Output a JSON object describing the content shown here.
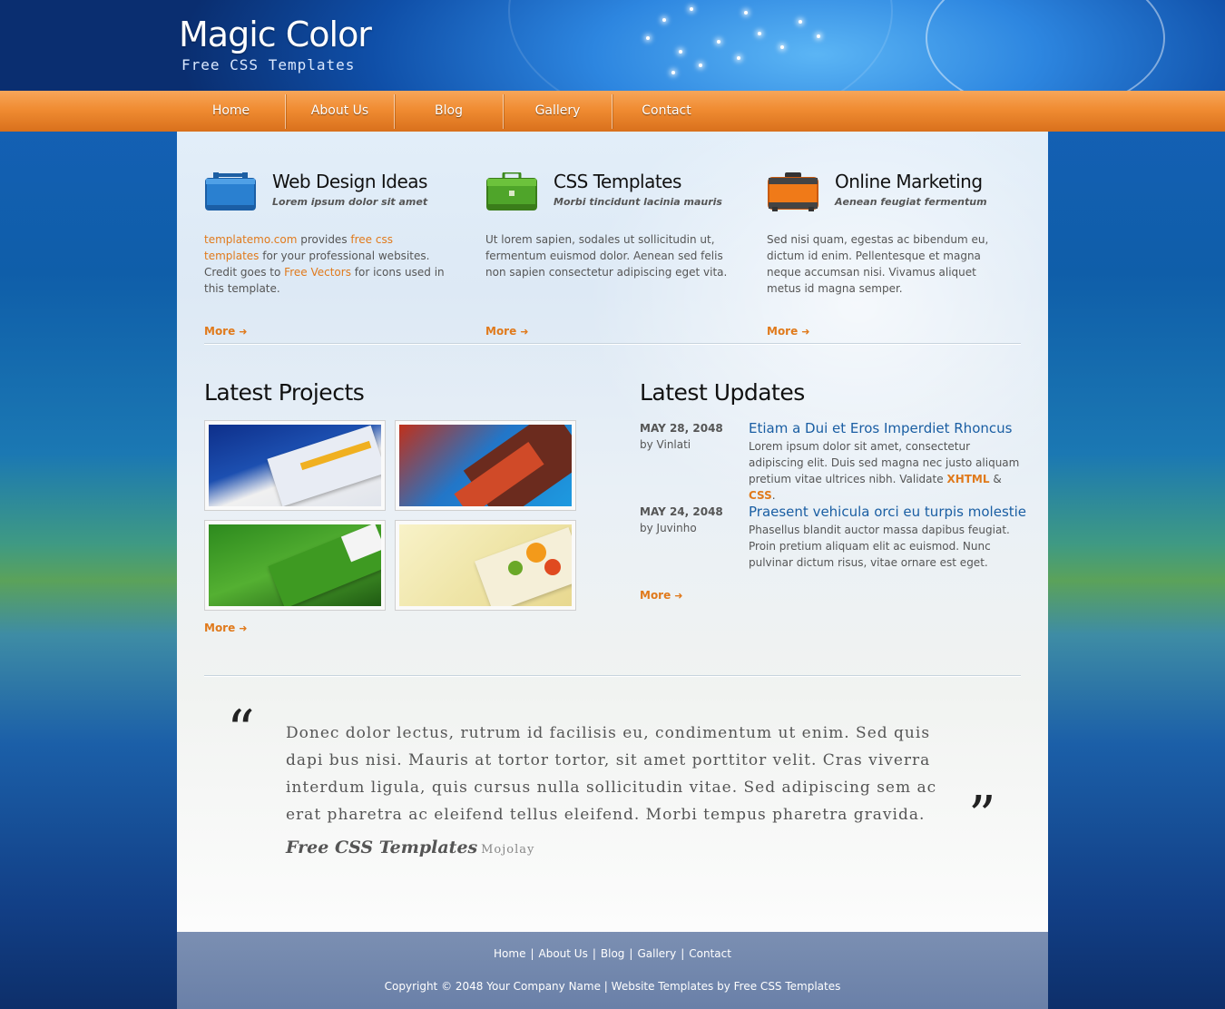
{
  "site": {
    "title": "Magic Color",
    "tagline": "Free CSS Templates"
  },
  "nav": {
    "items": [
      {
        "label": "Home"
      },
      {
        "label": "About Us"
      },
      {
        "label": "Blog"
      },
      {
        "label": "Gallery"
      },
      {
        "label": "Contact"
      }
    ]
  },
  "features": [
    {
      "icon": "blue-briefcase-icon",
      "title": "Web Design Ideas",
      "subtitle": "Lorem ipsum dolor sit amet",
      "text_parts": [
        "templatemo.com",
        " provides ",
        "free css templates",
        " for your professional websites. Credit goes to ",
        "Free Vectors",
        " for icons used in this template."
      ],
      "more": "More"
    },
    {
      "icon": "green-briefcase-icon",
      "title": "CSS Templates",
      "subtitle": "Morbi tincidunt lacinia mauris",
      "text": "Ut lorem sapien, sodales ut sollicitudin ut, fermentum euismod dolor. Aenean sed felis non sapien consectetur adipiscing eget vita.",
      "more": "More"
    },
    {
      "icon": "orange-suitcase-icon",
      "title": "Online Marketing",
      "subtitle": "Aenean feugiat fermentum",
      "text": "Sed nisi quam, egestas ac bibendum eu, dictum id enim. Pellentesque et magna neque accumsan nisi. Vivamus aliquet metus id magna semper.",
      "more": "More"
    }
  ],
  "projects": {
    "title": "Latest Projects",
    "more": "More"
  },
  "updates": {
    "title": "Latest Updates",
    "items": [
      {
        "date": "MAY 28, 2048",
        "by": "by Vinlati",
        "headline": "Etiam a Dui et Eros Imperdiet Rhoncus",
        "text": "Lorem ipsum dolor sit amet, consectetur adipiscing elit. Duis sed magna nec justo aliquam pretium vitae ultrices nibh. Validate ",
        "link1": "XHTML",
        "amp": " & ",
        "link2": "CSS",
        "end": "."
      },
      {
        "date": "MAY 24, 2048",
        "by": "by Juvinho",
        "headline": "Praesent vehicula orci eu turpis molestie",
        "text": "Phasellus blandit auctor massa dapibus feugiat. Proin pretium aliquam elit ac euismod. Nunc pulvinar dictum risus, vitae ornare est eget."
      }
    ],
    "more": "More"
  },
  "quote": {
    "text": "Donec dolor lectus, rutrum id facilisis eu, condimentum ut enim. Sed quis dapi bus nisi. Mauris at tortor tortor, sit amet porttitor velit. Cras viverra interdum ligula, quis cursus nulla sollicitudin vitae. Sed adipiscing sem ac erat pharetra ac eleifend tellus eleifend. Morbi tempus pharetra gravida.",
    "author": "Free CSS Templates",
    "source": "Mojolay",
    "open_mark": "“",
    "close_mark": "”"
  },
  "footer": {
    "links": [
      "Home",
      "About Us",
      "Blog",
      "Gallery",
      "Contact"
    ],
    "copyright": "Copyright © 2048 Your Company Name | Website Templates by Free CSS Templates"
  },
  "colors": {
    "accent": "#e07a1c",
    "nav": "#f08c32",
    "link": "#1a5ea3",
    "footer": "#7b8fb2"
  }
}
